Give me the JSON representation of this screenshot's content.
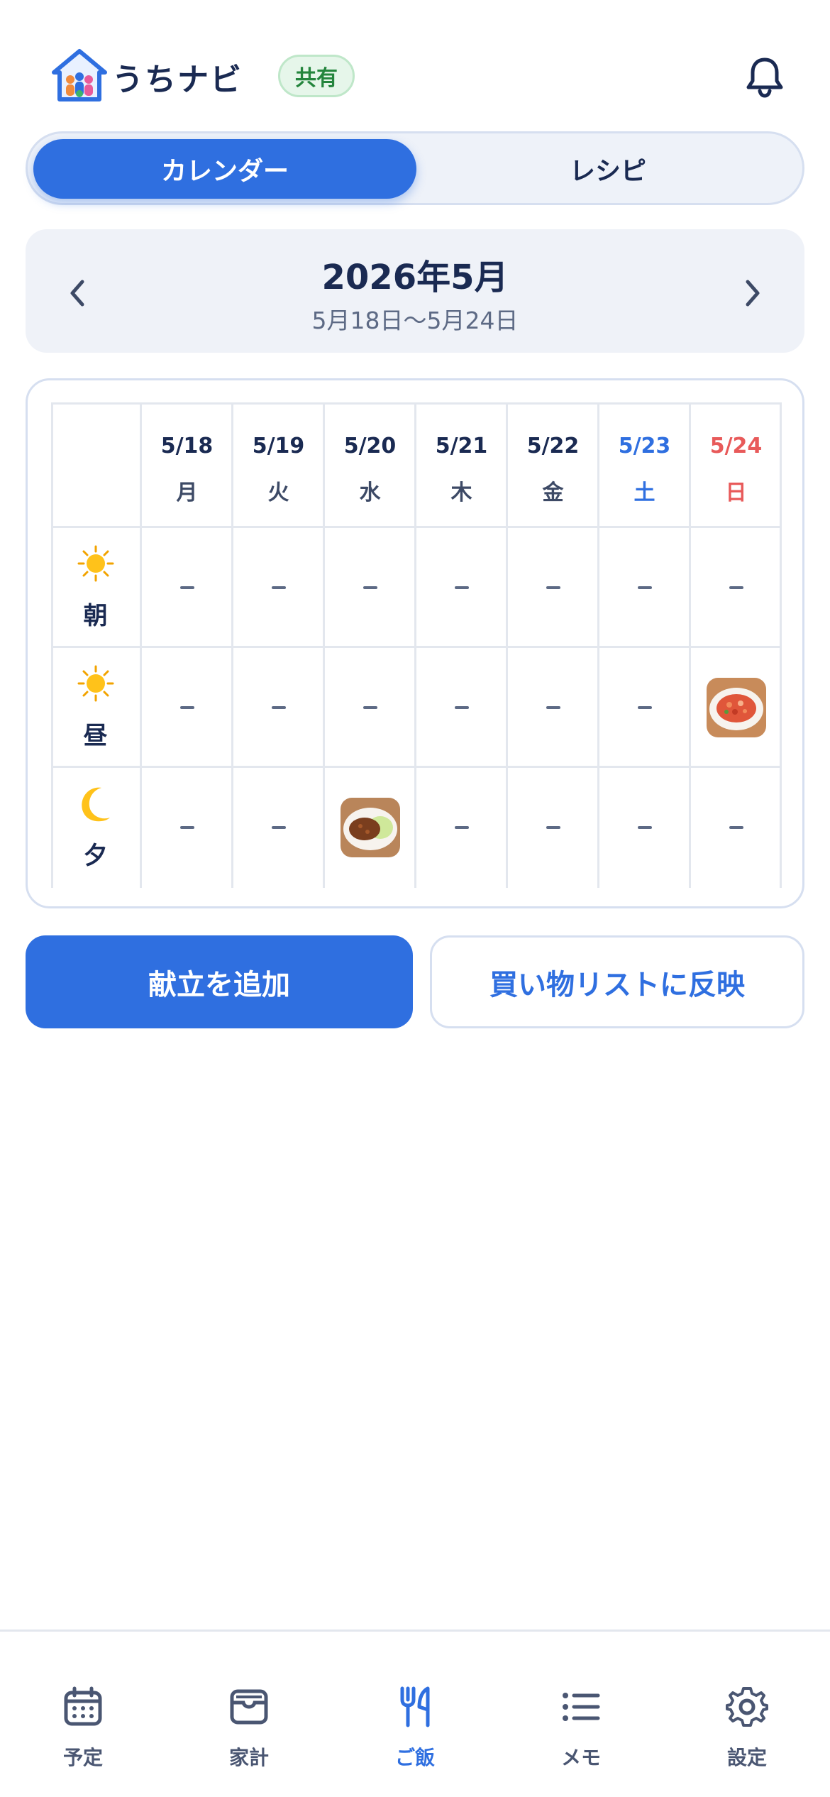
{
  "header": {
    "app_name": "うちナビ",
    "shared_badge": "共有",
    "bell_icon": "bell-icon"
  },
  "segment": {
    "tabs": [
      {
        "label": "カレンダー",
        "active": true
      },
      {
        "label": "レシピ",
        "active": false
      }
    ]
  },
  "calendar": {
    "month_title": "2026年5月",
    "week_range": "5月18日〜5月24日",
    "days": [
      {
        "date": "5/18",
        "weekday": "月"
      },
      {
        "date": "5/19",
        "weekday": "火"
      },
      {
        "date": "5/20",
        "weekday": "水"
      },
      {
        "date": "5/21",
        "weekday": "木"
      },
      {
        "date": "5/22",
        "weekday": "金"
      },
      {
        "date": "5/23",
        "weekday": "土"
      },
      {
        "date": "5/24",
        "weekday": "日"
      }
    ],
    "meals": [
      {
        "label": "朝",
        "icon": "sun-icon"
      },
      {
        "label": "昼",
        "icon": "sun-icon"
      },
      {
        "label": "夕",
        "icon": "moon-icon"
      }
    ],
    "empty_marker": "–",
    "entries": {
      "lunch_5_24": "tomato-pasta-dish",
      "dinner_5_20": "ginger-pork-with-cabbage-dish"
    }
  },
  "actions": {
    "add_menu": "献立を追加",
    "reflect_shopping": "買い物リストに反映"
  },
  "bottom_nav": {
    "tabs": [
      {
        "label": "予定",
        "icon": "calendar-icon"
      },
      {
        "label": "家計",
        "icon": "wallet-icon"
      },
      {
        "label": "ご飯",
        "icon": "utensils-icon",
        "active": true
      },
      {
        "label": "メモ",
        "icon": "list-icon"
      },
      {
        "label": "設定",
        "icon": "gear-icon"
      }
    ]
  },
  "colors": {
    "primary": "#2f6fe0",
    "text": "#1a2a52",
    "saturday": "#2f6fe0",
    "sunday": "#e85a5a",
    "badge_bg": "#e6f6ea",
    "badge_text": "#24853d"
  }
}
